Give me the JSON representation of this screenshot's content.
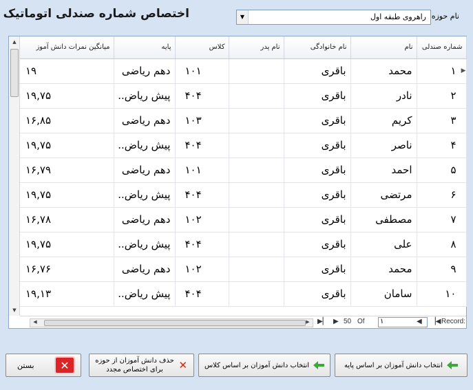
{
  "window": {
    "title": "اختصاص شماره صندلی اتوماتیک"
  },
  "zone": {
    "label": "نام حوزه",
    "selected": "راهروی طبقه اول"
  },
  "grid": {
    "headers": [
      "شماره صندلی",
      "نام",
      "نام خانوادگی",
      "نام پدر",
      "کلاس",
      "پایه",
      "میانگین نمرات دانش آموز"
    ],
    "rows": [
      {
        "seat": "۱",
        "name": "محمد",
        "family": "باقری",
        "father": "",
        "class": "۱۰۱",
        "grade": "دهم ریاضی",
        "avg": "۱۹"
      },
      {
        "seat": "۲",
        "name": "نادر",
        "family": "باقری",
        "father": "",
        "class": "۴۰۴",
        "grade": "پیش ریاض..",
        "avg": "۱۹,۷۵"
      },
      {
        "seat": "۳",
        "name": "کریم",
        "family": "باقری",
        "father": "",
        "class": "۱۰۳",
        "grade": "دهم ریاضی",
        "avg": "۱۶,۸۵"
      },
      {
        "seat": "۴",
        "name": "ناصر",
        "family": "باقری",
        "father": "",
        "class": "۴۰۴",
        "grade": "پیش ریاض..",
        "avg": "۱۹,۷۵"
      },
      {
        "seat": "۵",
        "name": "احمد",
        "family": "باقری",
        "father": "",
        "class": "۱۰۱",
        "grade": "دهم ریاضی",
        "avg": "۱۶,۷۹"
      },
      {
        "seat": "۶",
        "name": "مرتضی",
        "family": "باقری",
        "father": "",
        "class": "۴۰۴",
        "grade": "پیش ریاض..",
        "avg": "۱۹,۷۵"
      },
      {
        "seat": "۷",
        "name": "مصطفی",
        "family": "باقری",
        "father": "",
        "class": "۱۰۲",
        "grade": "دهم ریاضی",
        "avg": "۱۶,۷۸"
      },
      {
        "seat": "۸",
        "name": "علی",
        "family": "باقری",
        "father": "",
        "class": "۴۰۴",
        "grade": "پیش ریاض..",
        "avg": "۱۹,۷۵"
      },
      {
        "seat": "۹",
        "name": "محمد",
        "family": "باقری",
        "father": "",
        "class": "۱۰۲",
        "grade": "دهم ریاضی",
        "avg": "۱۶,۷۶"
      },
      {
        "seat": "۱۰",
        "name": "سامان",
        "family": "باقری",
        "father": "",
        "class": "۴۰۴",
        "grade": "پیش ریاض..",
        "avg": "۱۹,۱۳"
      }
    ]
  },
  "navigator": {
    "record_label": "Record:",
    "of_label": "Of",
    "total": "50",
    "current": "۱"
  },
  "buttons": {
    "by_grade": "انتخاب دانش آموزان بر اساس پایه",
    "by_class": "انتخاب دانش آموزان بر اساس کلاس",
    "delete_line1": "حذف دانش آموزان از حوزه",
    "delete_line2": "برای اختصاص مجدد",
    "close": "بستن"
  },
  "colors": {
    "background": "#d5e3f3",
    "accent_green": "#3aa83a",
    "accent_red": "#d92525"
  }
}
